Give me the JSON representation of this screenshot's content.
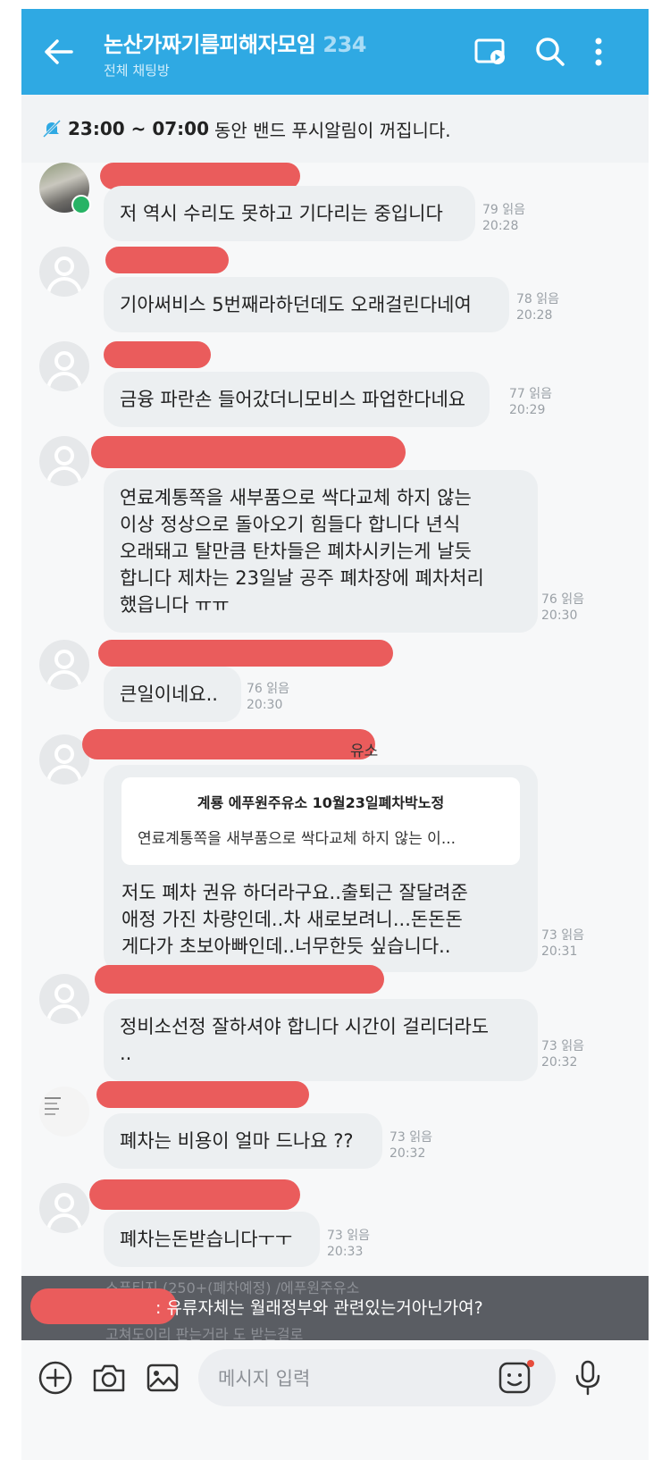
{
  "header": {
    "title": "논산가짜기름피해자모임",
    "member_count": "234",
    "subtitle": "전체 채팅방"
  },
  "notice": {
    "time": "23:00 ~ 07:00",
    "text": "동안 밴드 푸시알림이 꺼집니다."
  },
  "messages": [
    {
      "text": "저 역시 수리도 못하고 기다리는 중입니다",
      "read": "79 읽음",
      "time": "20:28"
    },
    {
      "text": "기아써비스 5번째라하던데도 오래걸린다네여",
      "read": "78 읽음",
      "time": "20:28"
    },
    {
      "text": "금융 파란손 들어갔더니모비스 파업한다네요",
      "read": "77 읽음",
      "time": "20:29"
    },
    {
      "lines": [
        "연료계통쪽을 새부품으로 싹다교체 하지 않는",
        "이상 정상으로 돌아오기 힘들다 합니다 년식",
        "오래돼고 탈만큼 탄차들은 폐차시키는게 날듯",
        "합니다 제차는 23일날 공주 폐차장에 폐차처리",
        "했읍니다 ㅠㅠ"
      ],
      "read": "76 읽음",
      "time": "20:30"
    },
    {
      "text": "큰일이네요..",
      "read": "76 읽음",
      "time": "20:30"
    },
    {
      "sender_suffix": "유소",
      "quote": {
        "title": "계룡 에푸원주유소  10월23일폐차박노정",
        "text": "연료계통쪽을 새부품으로 싹다교체 하지 않는 이..."
      },
      "lines": [
        "저도 폐차 권유 하더라구요..출퇴근 잘달려준",
        "애정 가진 차량인데..차 새로보려니...돈돈돈",
        "게다가 초보아빠인데..너무한듯 싶습니다.."
      ],
      "read": "73 읽음",
      "time": "20:31"
    },
    {
      "lines": [
        "정비소선정 잘하셔야 합니다 시간이 걸리더라도",
        ".."
      ],
      "read": "73 읽음",
      "time": "20:32"
    },
    {
      "text": "폐차는 비용이 얼마 드나요 ??",
      "read": "73 읽음",
      "time": "20:32"
    },
    {
      "text": "폐차는돈받습니다ㅜㅜ",
      "read": "73 읽음",
      "time": "20:33"
    }
  ],
  "reply_preview": {
    "text": ": 유류자체는 월래정부와 관련있는거아닌가여?",
    "ghost_top": "스푸티지 (250+(폐차예정) /에푸원주유소",
    "ghost_bottom": "고쳐도이리 판는거라 도 받는걸로"
  },
  "input": {
    "placeholder": "메시지 입력"
  },
  "icons": [
    "back-arrow-icon",
    "video-call-icon",
    "search-icon",
    "more-vertical-icon",
    "muted-bell-icon",
    "plus-circle-icon",
    "camera-icon",
    "image-icon",
    "emoticon-icon",
    "microphone-icon"
  ],
  "colors": {
    "header": "#2fa9e3",
    "bubble": "#eceff1",
    "redaction": "#ea5c5c",
    "member_count": "#a9dcf6",
    "manager_badge": "#27b365"
  }
}
